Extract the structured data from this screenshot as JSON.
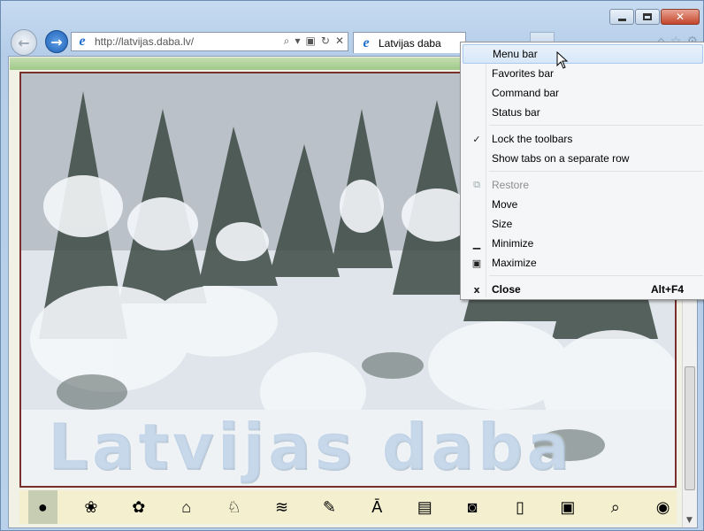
{
  "browser": {
    "url": "http://latvijas.daba.lv/",
    "tab_title": "Latvijas daba"
  },
  "page": {
    "banner_text": "Latvijas daba",
    "icon_names": [
      "stone-icon",
      "butterfly-landscape-icon",
      "flower-icon",
      "mushroom-icon",
      "deer-icon",
      "water-icon",
      "tools-icon",
      "abc-icon",
      "notes-icon",
      "camera-icon",
      "book-icon",
      "computer-icon",
      "magnifier-icon",
      "globe-icon"
    ]
  },
  "context_menu": {
    "items": [
      {
        "label": "Menu bar",
        "highlight": true
      },
      {
        "label": "Favorites bar"
      },
      {
        "label": "Command bar"
      },
      {
        "label": "Status bar"
      }
    ],
    "items2": [
      {
        "label": "Lock the toolbars",
        "icon": "✓"
      },
      {
        "label": "Show tabs on a separate row"
      }
    ],
    "items3": [
      {
        "label": "Restore",
        "disabled": true
      },
      {
        "label": "Move"
      },
      {
        "label": "Size"
      },
      {
        "label": "Minimize"
      },
      {
        "label": "Maximize"
      }
    ],
    "close": {
      "label": "Close",
      "shortcut": "Alt+F4",
      "icon": "x"
    }
  }
}
